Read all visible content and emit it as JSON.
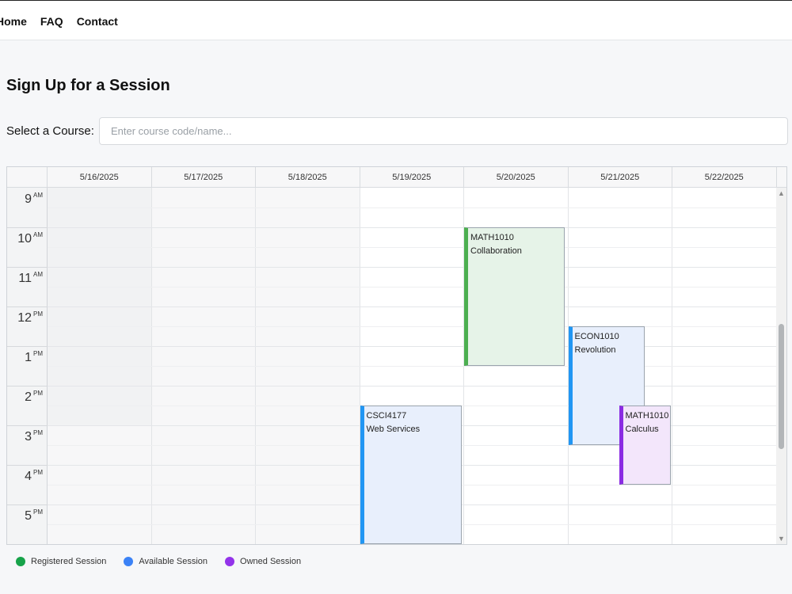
{
  "nav": {
    "items": [
      "Home",
      "FAQ",
      "Contact"
    ]
  },
  "page": {
    "title": "Sign Up for a Session"
  },
  "course": {
    "label": "Select a Course:",
    "placeholder": "Enter course code/name..."
  },
  "calendar": {
    "days": [
      "5/16/2025",
      "5/17/2025",
      "5/18/2025",
      "5/19/2025",
      "5/20/2025",
      "5/21/2025",
      "5/22/2025"
    ],
    "hours": [
      {
        "num": "9",
        "ampm": "AM"
      },
      {
        "num": "10",
        "ampm": "AM"
      },
      {
        "num": "11",
        "ampm": "AM"
      },
      {
        "num": "12",
        "ampm": "PM"
      },
      {
        "num": "1",
        "ampm": "PM"
      },
      {
        "num": "2",
        "ampm": "PM"
      },
      {
        "num": "3",
        "ampm": "PM"
      },
      {
        "num": "4",
        "ampm": "PM"
      },
      {
        "num": "5",
        "ampm": "PM"
      }
    ],
    "events": [
      {
        "code": "MATH1010",
        "name": "Collaboration",
        "day": "5/20/2025",
        "start": "10:00",
        "end": "13:30",
        "type": "registered"
      },
      {
        "code": "ECON1010",
        "name": "Revolution",
        "day": "5/21/2025",
        "start": "12:30",
        "end": "15:30",
        "type": "available"
      },
      {
        "code": "MATH1010",
        "name": "Calculus",
        "day": "5/21/2025",
        "start": "14:30",
        "end": "16:30",
        "type": "owned"
      },
      {
        "code": "CSCI4177",
        "name": "Web Services",
        "day": "5/19/2025",
        "start": "14:30",
        "end": "18:00",
        "type": "available"
      }
    ]
  },
  "legend": [
    {
      "label": "Registered Session",
      "color": "#17a34a"
    },
    {
      "label": "Available Session",
      "color": "#3b82f6"
    },
    {
      "label": "Owned Session",
      "color": "#9333ea"
    }
  ],
  "colors": {
    "registered": {
      "bar": "#4caf50",
      "fill": "#e6f3e8"
    },
    "available": {
      "bar": "#2196f3",
      "fill": "#e8effc"
    },
    "owned": {
      "bar": "#8a2be2",
      "fill": "#f3e6fb"
    }
  }
}
